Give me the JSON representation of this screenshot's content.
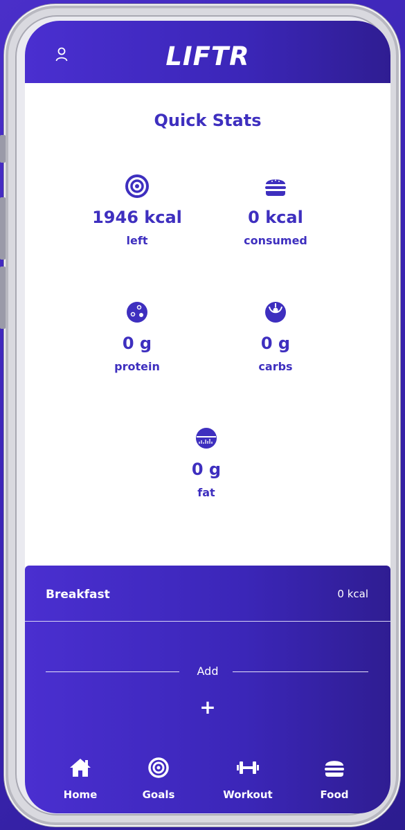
{
  "app": {
    "brand": "LIFTR"
  },
  "quick_stats": {
    "title": "Quick Stats",
    "items": [
      {
        "value": "1946 kcal",
        "label": "left",
        "icon": "target-icon"
      },
      {
        "value": "0 kcal",
        "label": "consumed",
        "icon": "burger-icon"
      },
      {
        "value": "0 g",
        "label": "protein",
        "icon": "cookie-icon"
      },
      {
        "value": "0 g",
        "label": "carbs",
        "icon": "carbs-icon"
      },
      {
        "value": "0 g",
        "label": "fat",
        "icon": "fat-icon"
      }
    ]
  },
  "meal": {
    "name": "Breakfast",
    "kcal": "0 kcal",
    "add_label": "Add",
    "add_symbol": "+"
  },
  "nav": {
    "items": [
      {
        "label": "Home",
        "icon": "home-icon"
      },
      {
        "label": "Goals",
        "icon": "target-icon"
      },
      {
        "label": "Workout",
        "icon": "dumbbell-icon"
      },
      {
        "label": "Food",
        "icon": "burger-icon"
      }
    ]
  },
  "colors": {
    "accent": "#3e2fbf",
    "bar": "#3b26b8",
    "background": "#ffffff"
  }
}
